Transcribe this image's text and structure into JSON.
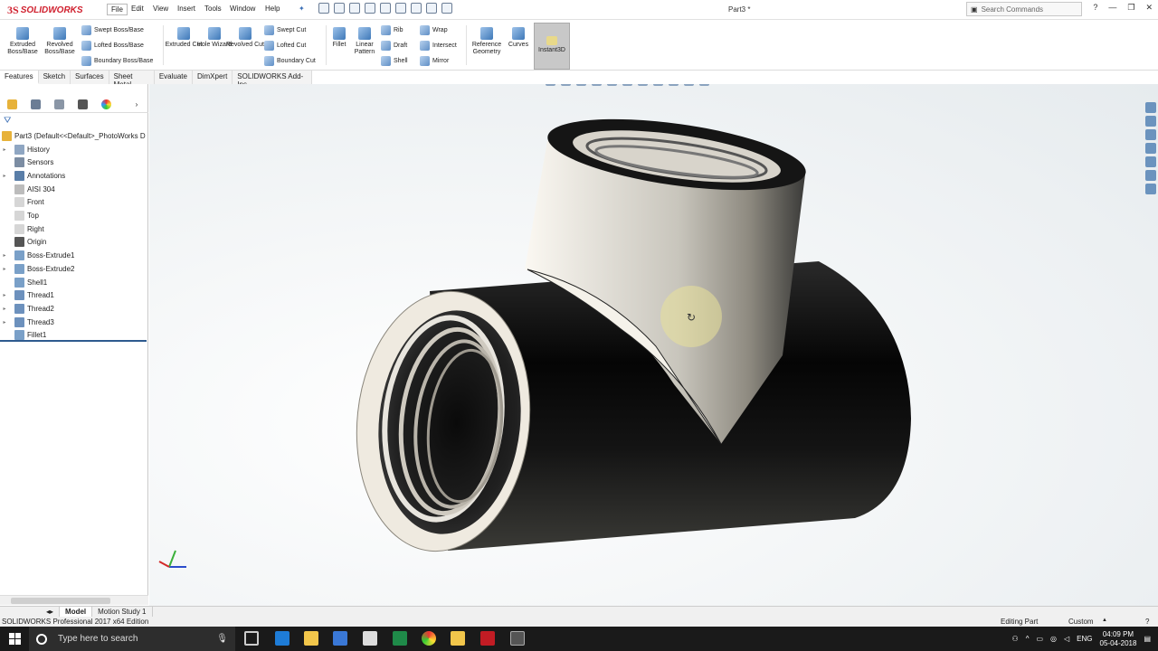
{
  "app": {
    "brand": "SOLIDWORKS",
    "doc_title": "Part3 *",
    "search_placeholder": "Search Commands",
    "help_icon": "?",
    "menu": [
      "File",
      "Edit",
      "View",
      "Insert",
      "Tools",
      "Window",
      "Help"
    ],
    "active_menu": "File"
  },
  "ribbon": {
    "extruded_boss": "Extruded Boss/Base",
    "revolved_boss": "Revolved Boss/Base",
    "swept_boss": "Swept Boss/Base",
    "lofted_boss": "Lofted Boss/Base",
    "boundary_boss": "Boundary Boss/Base",
    "extruded_cut": "Extruded Cut",
    "hole_wizard": "Hole Wizard",
    "revolved_cut": "Revolved Cut",
    "swept_cut": "Swept Cut",
    "lofted_cut": "Lofted Cut",
    "boundary_cut": "Boundary Cut",
    "fillet": "Fillet",
    "linear_pattern": "Linear Pattern",
    "rib": "Rib",
    "draft": "Draft",
    "shell": "Shell",
    "wrap": "Wrap",
    "intersect": "Intersect",
    "mirror": "Mirror",
    "reference_geometry": "Reference Geometry",
    "curves": "Curves",
    "instant3d": "Instant3D"
  },
  "command_tabs": [
    "Features",
    "Sketch",
    "Surfaces",
    "Sheet Metal",
    "Evaluate",
    "DimXpert",
    "SOLIDWORKS Add-Ins"
  ],
  "feature_tree": {
    "root": "Part3  (Default<<Default>_PhotoWorks D",
    "items": [
      {
        "label": "History",
        "expandable": true
      },
      {
        "label": "Sensors",
        "expandable": false
      },
      {
        "label": "Annotations",
        "expandable": true
      },
      {
        "label": "AISI 304",
        "expandable": false
      },
      {
        "label": "Front",
        "expandable": false
      },
      {
        "label": "Top",
        "expandable": false
      },
      {
        "label": "Right",
        "expandable": false
      },
      {
        "label": "Origin",
        "expandable": false
      },
      {
        "label": "Boss-Extrude1",
        "expandable": true
      },
      {
        "label": "Boss-Extrude2",
        "expandable": true
      },
      {
        "label": "Shell1",
        "expandable": false
      },
      {
        "label": "Thread1",
        "expandable": true
      },
      {
        "label": "Thread2",
        "expandable": true
      },
      {
        "label": "Thread3",
        "expandable": true
      },
      {
        "label": "Fillet1",
        "expandable": false
      }
    ]
  },
  "bottom_tabs": [
    "Model",
    "Motion Study 1"
  ],
  "status": {
    "edition": "SOLIDWORKS Professional 2017 x64 Edition",
    "mode": "Editing Part",
    "units": "Custom"
  },
  "taskbar": {
    "search_placeholder": "Type here to search",
    "lang": "ENG",
    "time": "04:09 PM",
    "date": "05-04-2018"
  },
  "colors": {
    "brand_red": "#d0202e",
    "accent_blue": "#2e5a8f",
    "taskbar": "#1a1a1a"
  }
}
